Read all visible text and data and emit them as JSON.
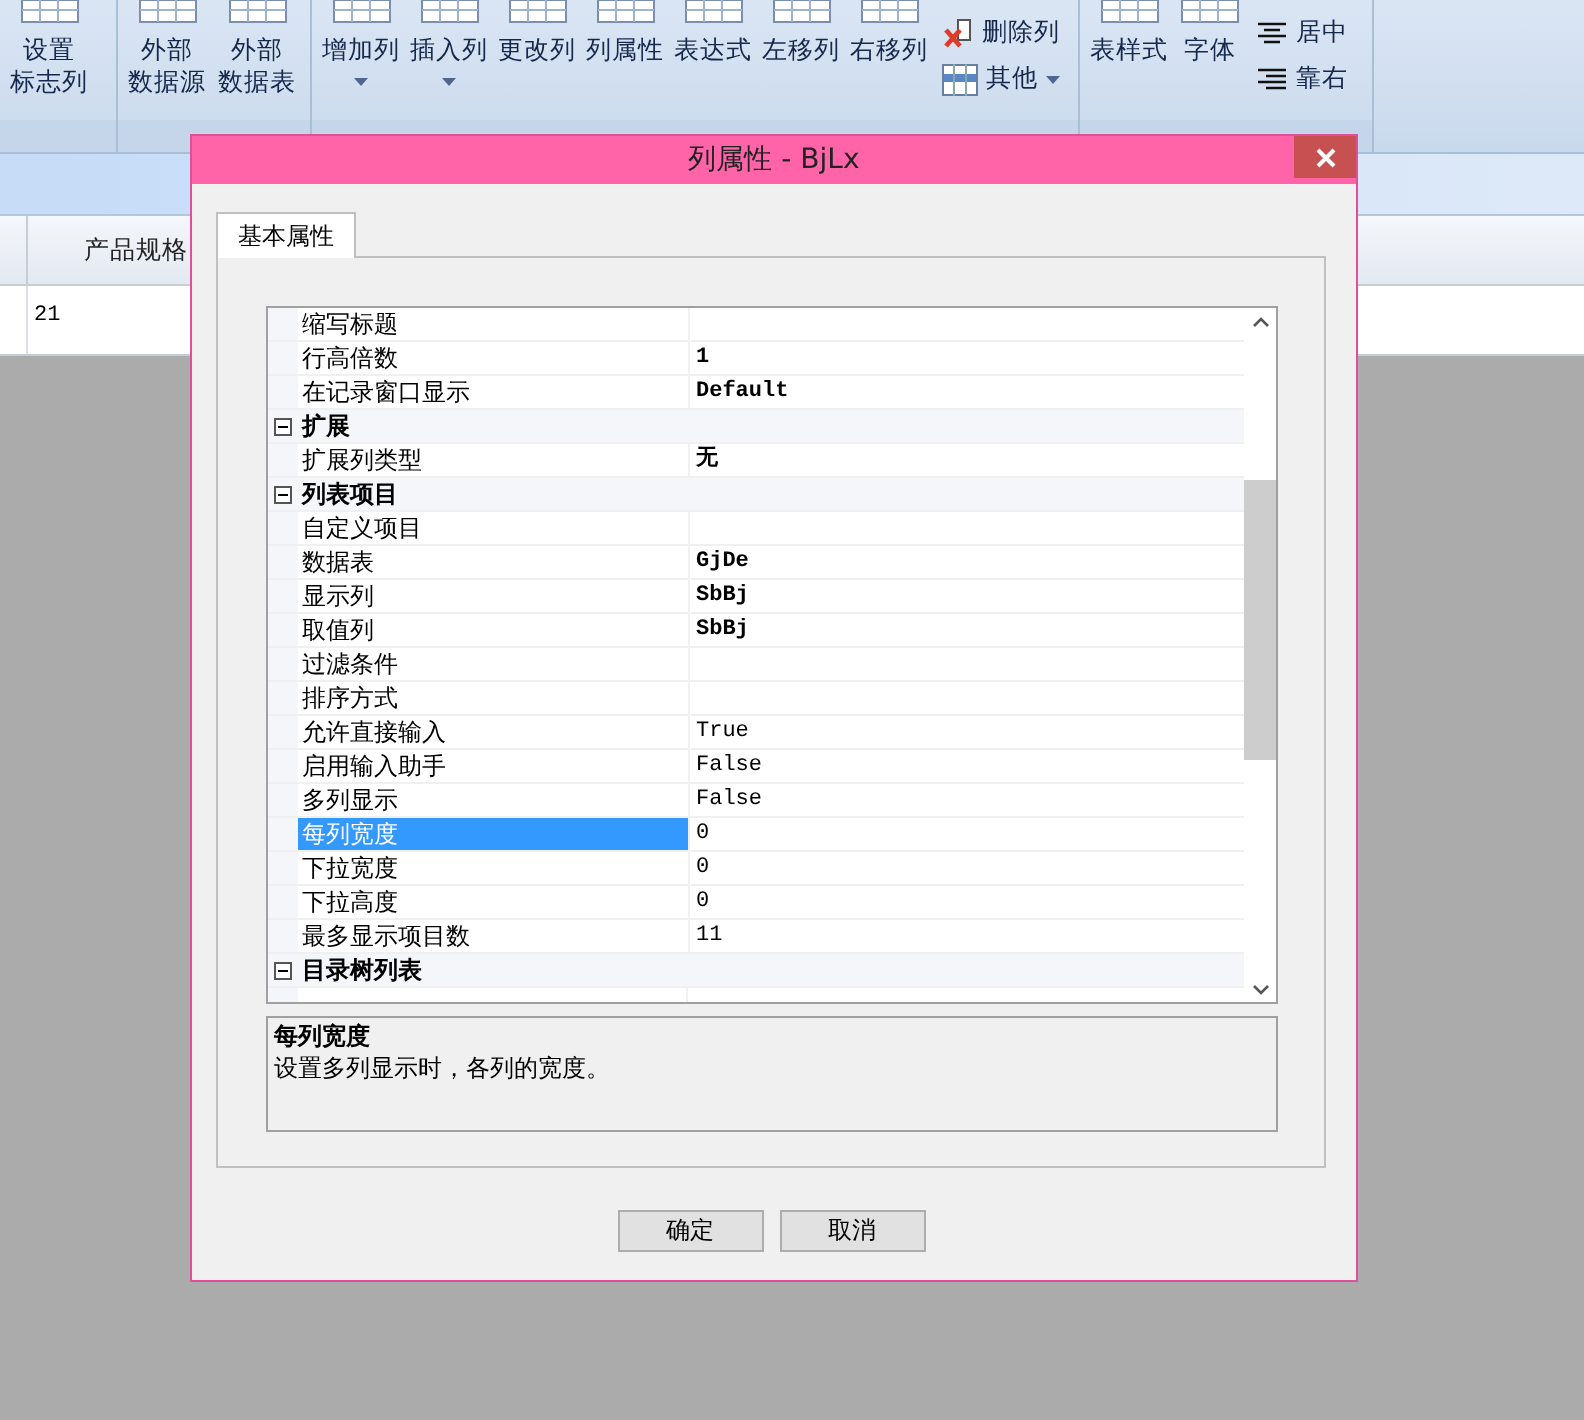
{
  "ribbon": {
    "groups": [
      {
        "buttons": [
          {
            "lines": [
              "设置",
              "标志列"
            ],
            "kind": "large",
            "caret": false
          }
        ]
      },
      {
        "buttons": [
          {
            "lines": [
              "外部",
              "数据源"
            ],
            "kind": "large",
            "caret": false
          },
          {
            "lines": [
              "外部",
              "数据表"
            ],
            "kind": "large",
            "caret": false
          }
        ]
      },
      {
        "buttons": [
          {
            "lines": [
              "增加列"
            ],
            "kind": "large",
            "caret": true
          },
          {
            "lines": [
              "插入列"
            ],
            "kind": "large",
            "caret": true
          },
          {
            "lines": [
              "更改列"
            ],
            "kind": "large",
            "caret": false
          },
          {
            "lines": [
              "列属性"
            ],
            "kind": "large",
            "caret": false
          },
          {
            "lines": [
              "表达式"
            ],
            "kind": "large",
            "caret": false
          },
          {
            "lines": [
              "左移列"
            ],
            "kind": "large",
            "caret": false
          },
          {
            "lines": [
              "右移列"
            ],
            "kind": "large",
            "caret": false
          },
          {
            "lines": [
              "删除列"
            ],
            "kind": "small",
            "caret": false
          },
          {
            "lines": [
              "其他"
            ],
            "kind": "small",
            "caret": true
          }
        ]
      },
      {
        "buttons": [
          {
            "lines": [
              "表样式"
            ],
            "kind": "large",
            "caret": false
          },
          {
            "lines": [
              "字体"
            ],
            "kind": "large",
            "caret": false
          },
          {
            "lines": [
              "居中"
            ],
            "kind": "small",
            "caret": false
          },
          {
            "lines": [
              "靠右"
            ],
            "kind": "small",
            "caret": false
          }
        ]
      }
    ]
  },
  "table": {
    "columns": [
      "产品规格"
    ],
    "rows": [
      [
        "21"
      ]
    ]
  },
  "dialog": {
    "title": "列属性 - BjLx",
    "tabs": [
      {
        "label": "基本属性",
        "selected": true
      }
    ],
    "grid": [
      {
        "kind": "property",
        "name": "缩写标题",
        "selected": false
      },
      {
        "kind": "property",
        "name": "行高倍数",
        "value": "1",
        "bold": true,
        "selected": false
      },
      {
        "kind": "property",
        "name": "在记录窗口显示",
        "value": "Default",
        "bold": true,
        "selected": false
      },
      {
        "kind": "category",
        "name": "扩展",
        "expanded": true
      },
      {
        "kind": "property",
        "name": "扩展列类型",
        "value": "无",
        "bold": true,
        "selected": false
      },
      {
        "kind": "category",
        "name": "列表项目",
        "expanded": true
      },
      {
        "kind": "property",
        "name": "自定义项目",
        "selected": false
      },
      {
        "kind": "property",
        "name": "数据表",
        "value": "GjDe",
        "bold": true,
        "selected": false
      },
      {
        "kind": "property",
        "name": "显示列",
        "value": "SbBj",
        "bold": true,
        "selected": false
      },
      {
        "kind": "property",
        "name": "取值列",
        "value": "SbBj",
        "bold": true,
        "selected": false
      },
      {
        "kind": "property",
        "name": "过滤条件",
        "selected": false
      },
      {
        "kind": "property",
        "name": "排序方式",
        "selected": false
      },
      {
        "kind": "property",
        "name": "允许直接输入",
        "value": "True",
        "bold": false,
        "selected": false
      },
      {
        "kind": "property",
        "name": "启用输入助手",
        "value": "False",
        "bold": false,
        "selected": false
      },
      {
        "kind": "property",
        "name": "多列显示",
        "value": "False",
        "bold": false,
        "selected": false
      },
      {
        "kind": "property",
        "name": "每列宽度",
        "value": "0",
        "bold": false,
        "selected": true
      },
      {
        "kind": "property",
        "name": "下拉宽度",
        "value": "0",
        "bold": false,
        "selected": false
      },
      {
        "kind": "property",
        "name": "下拉高度",
        "value": "0",
        "bold": false,
        "selected": false
      },
      {
        "kind": "property",
        "name": "最多显示项目数",
        "value": "11",
        "bold": false,
        "selected": false
      },
      {
        "kind": "category",
        "name": "目录树列表",
        "expanded": true
      }
    ],
    "description": {
      "title": "每列宽度",
      "text": "设置多列显示时，各列的宽度。"
    },
    "buttons": [
      "确定",
      "取消"
    ]
  }
}
